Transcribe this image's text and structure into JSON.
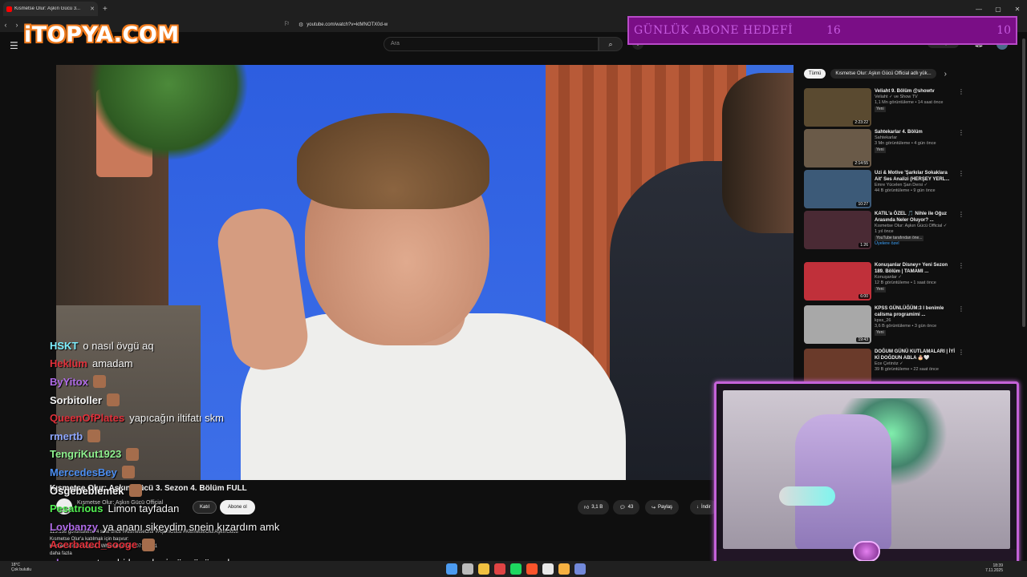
{
  "browser": {
    "tab_title": "Kısmetse Olur: Aşkın Gücü 3...",
    "url": "youtube.com/watch?v=ktMNOTX0d-w",
    "window_controls": [
      "—",
      "▢",
      "✕"
    ]
  },
  "logo_text": "iTOPYA.COM",
  "youtube": {
    "search_placeholder": "Ara",
    "create_label": "+ Oluştur"
  },
  "goal": {
    "label": "GÜNLÜK ABONE HEDEFİ",
    "current": "16",
    "target": "10"
  },
  "video": {
    "title": "Kısmetse Olur: Aşkın Gücü 3. Sezon 4. Bölüm FULL",
    "channel": "Kısmetse Olur: Aşkın Gücü Official",
    "join_label": "Katıl",
    "subscribe_label": "Abone ol",
    "likes": "3,1 B",
    "comments": "43",
    "share_label": "Paylaş",
    "download_label": "İndir",
    "desc_stats": "115.159 görüntüleme  4 saat önce  #KismetseOlur #AşkınGücü #KismetseOlurAşkınGücü",
    "desc_line2": "Kısmetse Olur'a katılmak için başvur:",
    "desc_line3": "Hemen sen de başvur : Whatsapp  0533 071 77 41",
    "desc_more": "daha fazla"
  },
  "chat": [
    {
      "nick": "HSKT",
      "color": "#7ff0ff",
      "msg": "o nasıl övgü aq",
      "emote": false
    },
    {
      "nick": "Heklüm",
      "color": "#e0303a",
      "msg": "amadam",
      "emote": false
    },
    {
      "nick": "ByYitox",
      "color": "#b06be8",
      "msg": "",
      "emote": true
    },
    {
      "nick": "Sorbitoller",
      "color": "#f4f4f4",
      "msg": "",
      "emote": true
    },
    {
      "nick": "QueenOfPlates",
      "color": "#e0303a",
      "msg": "yapıcağın iltifatı skm",
      "emote": false
    },
    {
      "nick": "rmertb",
      "color": "#8fa8ff",
      "msg": "",
      "emote": true
    },
    {
      "nick": "TengriKut1923",
      "color": "#8ef08e",
      "msg": "",
      "emote": true
    },
    {
      "nick": "MercedesBey",
      "color": "#4c8ef0",
      "msg": "",
      "emote": true
    },
    {
      "nick": "Osgebeblemek",
      "color": "#f4f4f4",
      "msg": "",
      "emote": true
    },
    {
      "nick": "Pesatrious",
      "color": "#52f052",
      "msg": "Limon tayfadan",
      "emote": false
    },
    {
      "nick": "Lovbanzy",
      "color": "#b06be8",
      "msg": "ya ananı sikeydim snein kızardım amk",
      "emote": false
    },
    {
      "nick": "Acerbated_sooge",
      "color": "#e0303a",
      "msg": "",
      "emote": true
    },
    {
      "nick": "ghaer",
      "color": "#b06be8",
      "msg": "ya tam bi karadeniz övgüsü amk",
      "emote": false
    }
  ],
  "sidebar": {
    "chips": [
      "Tümü",
      "Kısmetse Olur: Aşkın Gücü Official adlı yük..."
    ],
    "recommendations": [
      {
        "title": "Veliaht 9. Bölüm @showtv",
        "channel": "Veliaht ✓ ve Show TV",
        "stats": "1,1 Mn görüntüleme • 14 saat önce",
        "badge": "Yeni",
        "duration": "2:23:22",
        "color": "#5a4a30"
      },
      {
        "title": "Sahtekarlar 4. Bölüm",
        "channel": "Sahtekarlar",
        "stats": "3 Mn görüntüleme • 4 gün önce",
        "badge": "Yeni",
        "duration": "2:14:55",
        "color": "#6a5a48"
      },
      {
        "title": "Uzi & Motive 'Şarkılar Sokaklara Ait' Ses Analizi (HERŞEY YERL...",
        "channel": "Emre Yücelen Şan Dersi ✓",
        "stats": "44 B görüntüleme • 9 gün önce",
        "badge": "",
        "duration": "10:27",
        "color": "#3c5a78"
      },
      {
        "title": "KATIL'a ÖZEL 🎵 Nihle ile Oğuz Arasında Neler Oluyor? ...",
        "channel": "Kısmetse Olur: Aşkın Gücü Official ✓",
        "stats": "1 yıl önce",
        "badge": "YouTube tarafından öne...",
        "extra": "Üyelere özel",
        "duration": "1:26",
        "color": "#4a2a34"
      },
      {
        "title": "Konuşanlar Disney+ Yeni Sezon 189. Bölüm | TAMAMI ...",
        "channel": "Konuşanlar ✓",
        "stats": "12 B görüntüleme • 1 saat önce",
        "badge": "Yeni",
        "duration": "6:00",
        "color": "#c0303a"
      },
      {
        "title": "KPSS GÜNLÜĞÜM:3 I benimle calisma programimi ...",
        "channel": "kpss_26",
        "stats": "3,6 B görüntüleme • 3 gün önce",
        "badge": "Yeni",
        "duration": "19:43",
        "color": "#a8a8a8"
      },
      {
        "title": "DOĞUM GÜNÜ KUTLAMALARI | İYİ Kİ DOĞDUN ABLA 🎂🤍",
        "channel": "Ece Çetinöz ✓",
        "stats": "39 B görüntüleme • 22 saat önce",
        "badge": "",
        "duration": "",
        "color": "#6a3a2a"
      }
    ]
  },
  "taskbar": {
    "weather_temp": "18°C",
    "weather_desc": "Çok bulutlu",
    "time": "18:39",
    "date": "7.11.2025"
  },
  "colors": {
    "goal_bg": "#7a0e86",
    "cam_border": "#c462d8",
    "logo_orange": "#f07b1d"
  }
}
